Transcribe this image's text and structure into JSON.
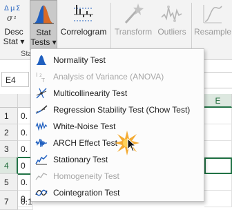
{
  "ribbon": {
    "buttons": [
      {
        "id": "desc-stat",
        "label": "Desc\nStat",
        "icon": "desc-stat-icon",
        "enabled": true
      },
      {
        "id": "stat-tests",
        "label": "Stat\nTests",
        "icon": "bell-curve-icon",
        "enabled": true,
        "active": true
      },
      {
        "id": "correlogram",
        "label": "Correlogram",
        "icon": "correlogram-icon",
        "enabled": true
      },
      {
        "id": "transform",
        "label": "Transform",
        "icon": "magic-wand-icon",
        "enabled": false
      },
      {
        "id": "outliers",
        "label": "Outliers",
        "icon": "outliers-icon",
        "enabled": false
      },
      {
        "id": "resample",
        "label": "Resample",
        "icon": "resample-icon",
        "enabled": false
      }
    ],
    "desc_stat_line1": "Desc",
    "desc_stat_line2": "Stat",
    "stat_tests_line1": "Stat",
    "stat_tests_line2": "Tests",
    "group_label_fragment": "Sta"
  },
  "name_box": "E4",
  "grid": {
    "visible_columns": [
      "E"
    ],
    "selected_column": "E",
    "rows": [
      "1",
      "2",
      "3",
      "4",
      "5",
      "6",
      "7"
    ],
    "selected_row": "4",
    "row_cells": [
      "0.",
      "0.",
      "0.",
      "0",
      "0.",
      "0.",
      "0.1"
    ]
  },
  "menu": {
    "items": [
      {
        "label": "Normality Test",
        "icon": "normality-icon",
        "enabled": true
      },
      {
        "label": "Analysis of Variance (ANOVA)",
        "icon": "anova-icon",
        "enabled": false
      },
      {
        "label": "Multicollinearity Test",
        "icon": "multicollinearity-icon",
        "enabled": true
      },
      {
        "label": "Regression Stability Test (Chow Test)",
        "icon": "chow-test-icon",
        "enabled": true
      },
      {
        "label": "White-Noise Test",
        "icon": "white-noise-icon",
        "enabled": true
      },
      {
        "label": "ARCH Effect Test",
        "icon": "arch-effect-icon",
        "enabled": true,
        "hovered": true
      },
      {
        "label": "Stationary Test",
        "icon": "stationary-icon",
        "enabled": true
      },
      {
        "label": "Homogeneity Test",
        "icon": "homogeneity-icon",
        "enabled": false
      },
      {
        "label": "Cointegration Test",
        "icon": "cointegration-icon",
        "enabled": true
      }
    ]
  },
  "colors": {
    "excel_green": "#217346",
    "accent_blue": "#1f5fbf",
    "burst_orange": "#f3a21d"
  }
}
